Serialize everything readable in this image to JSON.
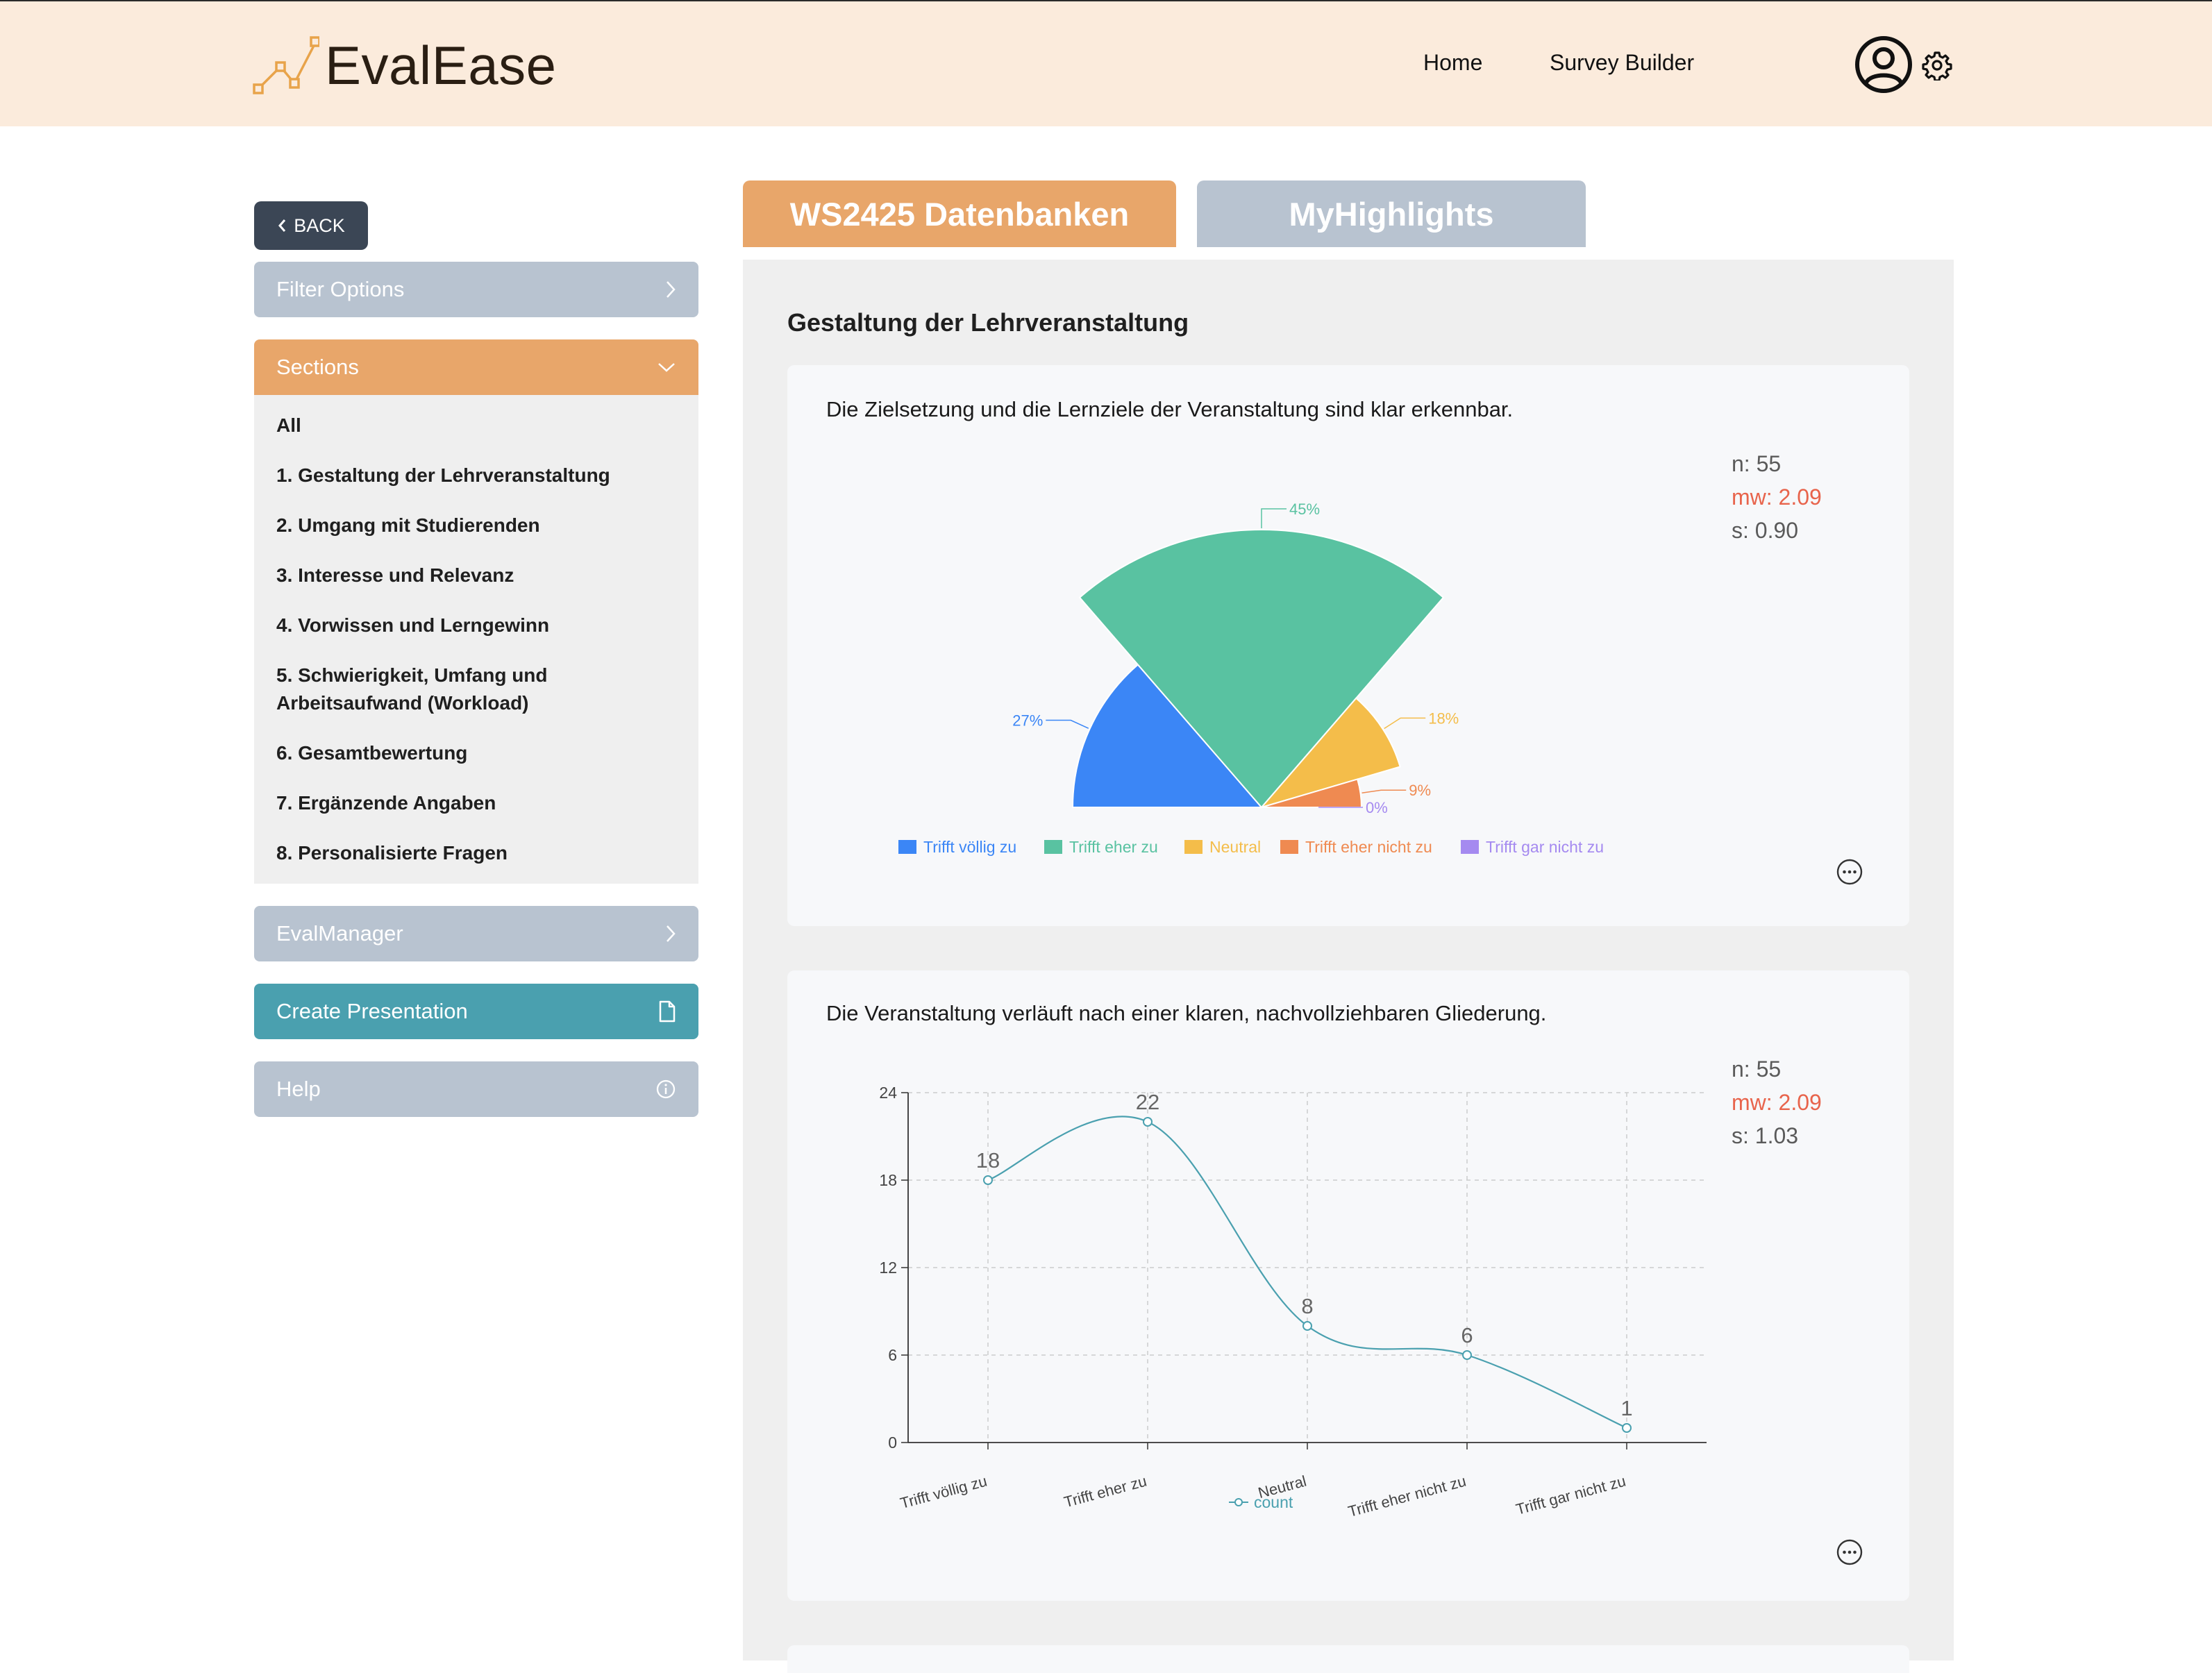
{
  "header": {
    "logo_text": "EvalEase",
    "nav": [
      "Home",
      "Survey Builder"
    ]
  },
  "sidebar": {
    "back_label": "BACK",
    "filter_label": "Filter Options",
    "sections_label": "Sections",
    "sections": [
      "All",
      "1. Gestaltung der Lehrveranstaltung",
      "2. Umgang mit Studierenden",
      "3. Interesse und Relevanz",
      "4. Vorwissen und Lerngewinn",
      "5. Schwierigkeit, Umfang und Arbeitsaufwand (Workload)",
      "6. Gesamtbewertung",
      "7. Ergänzende Angaben",
      "8. Personalisierte Fragen"
    ],
    "section5_line1": "5. Schwierigkeit, Umfang und",
    "section5_line2": "Arbeitsaufwand (Workload)",
    "evalmanager_label": "EvalManager",
    "presentation_label": "Create Presentation",
    "help_label": "Help"
  },
  "tabs": [
    "WS2425 Datenbanken",
    "MyHighlights"
  ],
  "main": {
    "section_title": "Gestaltung der Lehrveranstaltung",
    "questions": [
      {
        "text": "Die Zielsetzung und die Lernziele der Veranstaltung sind klar erkennbar.",
        "n": "n: 55",
        "mw": "mw: 2.09",
        "s": "s: 0.90"
      },
      {
        "text": "Die Veranstaltung verläuft nach einer klaren, nachvollziehbaren Gliederung.",
        "n": "n: 55",
        "mw": "mw: 2.09",
        "s": "s: 1.03"
      }
    ]
  },
  "colors": {
    "accent_orange": "#e8a66a",
    "header_bg": "#fbebdc",
    "teal": "#4aa0af",
    "blue": "#3b86f6",
    "green": "#59c2a1",
    "yellow": "#f4bd4a",
    "orange": "#ef8a51",
    "purple": "#a58af0",
    "line": "#4aa0af"
  },
  "icons": [
    "logo-icon",
    "avatar-icon",
    "gear-icon",
    "chevron-left-icon",
    "chevron-right-icon",
    "chevron-down-icon",
    "document-icon",
    "info-icon",
    "more-icon"
  ],
  "chart_data": [
    {
      "type": "pie",
      "variant": "half-pie, rose",
      "categories": [
        "Trifft völlig zu",
        "Trifft eher zu",
        "Neutral",
        "Trifft eher nicht zu",
        "Trifft gar nicht zu"
      ],
      "values": [
        15,
        25,
        10,
        5,
        0
      ],
      "percent_labels": [
        "27%",
        "45%",
        "18%",
        "9%",
        "0%"
      ],
      "legend": "bottom"
    },
    {
      "type": "line",
      "smooth": true,
      "categories": [
        "Trifft völlig zu",
        "Trifft eher zu",
        "Neutral",
        "Trifft eher nicht zu",
        "Trifft gar nicht zu"
      ],
      "series": [
        {
          "name": "count",
          "values": [
            18,
            22,
            8,
            6,
            1
          ]
        }
      ],
      "ylim": [
        0,
        24
      ],
      "yticks": [
        0,
        6,
        12,
        18,
        24
      ],
      "grid": true,
      "legend": "bottom"
    }
  ]
}
